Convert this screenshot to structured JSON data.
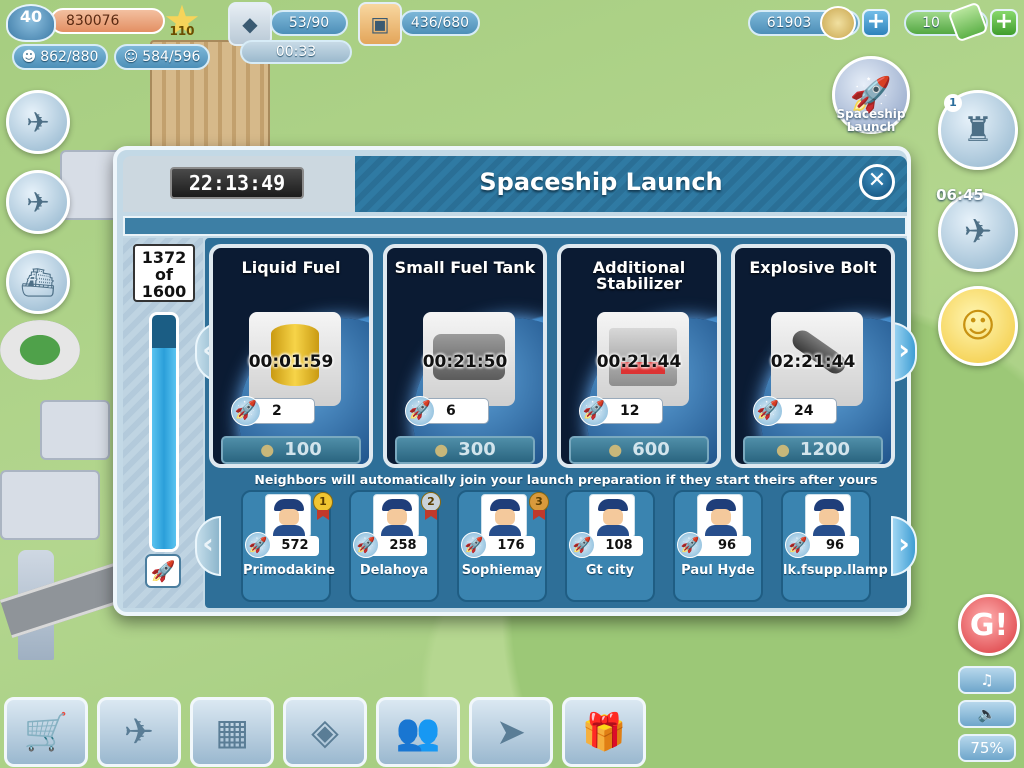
{
  "hud": {
    "level": "40",
    "xp": "830076",
    "star_level": "110",
    "fuel": "53/90",
    "fuel_timer": "00:33",
    "cargo": "436/680",
    "population": "862/880",
    "workers": "584/596",
    "coins": "61903",
    "bucks": "10"
  },
  "side": {
    "spaceship_launch_label": "Spaceship Launch",
    "radar_badge": "1",
    "flight_timer": "06:45",
    "zoom_label": "75%"
  },
  "modal": {
    "title": "Spaceship Launch",
    "timer": "22:13:49",
    "progress_current": "1372",
    "progress_of": "of",
    "progress_total": "1600",
    "progress_fraction": 0.8575,
    "close_symbol": "✕",
    "neighbors_note": "Neighbors will automatically join your launch preparation if they start theirs after yours",
    "parts": [
      {
        "name": "Liquid Fuel",
        "timer": "00:01:59",
        "qty": "2",
        "price": "100",
        "image": "fuel-barrel-icon"
      },
      {
        "name": "Small Fuel Tank",
        "timer": "00:21:50",
        "qty": "6",
        "price": "300",
        "image": "fuel-tank-icon"
      },
      {
        "name": "Additional Stabilizer",
        "timer": "00:21:44",
        "qty": "12",
        "price": "600",
        "image": "stabilizer-icon"
      },
      {
        "name": "Explosive Bolt",
        "timer": "02:21:44",
        "qty": "24",
        "price": "1200",
        "image": "explosive-bolt-icon"
      }
    ],
    "neighbors": [
      {
        "name": "Primodakine",
        "score": "572",
        "medal": "1"
      },
      {
        "name": "Delahoya",
        "score": "258",
        "medal": "2"
      },
      {
        "name": "Sophiemay",
        "score": "176",
        "medal": "3"
      },
      {
        "name": "Gt city",
        "score": "108",
        "medal": ""
      },
      {
        "name": "Paul Hyde",
        "score": "96",
        "medal": ""
      },
      {
        "name": "lk.fsupp.llamp",
        "score": "96",
        "medal": ""
      }
    ]
  },
  "colors": {
    "modal_header": "#2f7aa3",
    "gold_medal": "#f0c531",
    "silver_medal": "#c9d2da",
    "bronze_medal": "#d99a3c"
  }
}
